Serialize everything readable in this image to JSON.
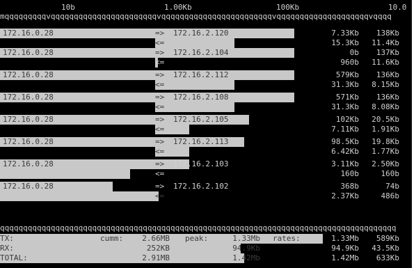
{
  "scale": {
    "labels": [
      "10b",
      "1.00Kb",
      "100Kb",
      "10.0"
    ]
  },
  "top_separator": "mqqqqqqqqqvqqqqqqqqqqqqqqqqqqqqqqqvqqqqqqqqqqqqqqqqqqqqqqqqvqqqqqqqqqqqqqqqqqqqqvqqqq",
  "sent_arrow": "=>",
  "recv_arrow": "<=",
  "connections": [
    {
      "src": "172.16.0.28",
      "dst": "172.16.2.120",
      "tx": {
        "r1": "7.33Kb",
        "r2": "138Kb"
      },
      "rx": {
        "r1": "15.3Kb",
        "r2": "11.4Kb"
      }
    },
    {
      "src": "172.16.0.28",
      "dst": "172.16.2.104",
      "tx": {
        "r1": "0b",
        "r2": "137Kb"
      },
      "rx": {
        "r1": "960b",
        "r2": "11.6Kb"
      }
    },
    {
      "src": "172.16.0.28",
      "dst": "172.16.2.112",
      "tx": {
        "r1": "579Kb",
        "r2": "136Kb"
      },
      "rx": {
        "r1": "31.3Kb",
        "r2": "8.15Kb"
      }
    },
    {
      "src": "172.16.0.28",
      "dst": "172.16.2.108",
      "tx": {
        "r1": "571Kb",
        "r2": "136Kb"
      },
      "rx": {
        "r1": "31.3Kb",
        "r2": "8.08Kb"
      }
    },
    {
      "src": "172.16.0.28",
      "dst": "172.16.2.105",
      "tx": {
        "r1": "102Kb",
        "r2": "20.5Kb"
      },
      "rx": {
        "r1": "7.11Kb",
        "r2": "1.91Kb"
      }
    },
    {
      "src": "172.16.0.28",
      "dst": "172.16.2.113",
      "tx": {
        "r1": "98.5Kb",
        "r2": "19.8Kb"
      },
      "rx": {
        "r1": "6.42Kb",
        "r2": "1.77Kb"
      }
    },
    {
      "src": "172.16.0.28",
      "dst": "172.16.2.103",
      "tx": {
        "r1": "3.11Kb",
        "r2": "2.50Kb"
      },
      "rx": {
        "r1": "160b",
        "r2": "160b"
      }
    },
    {
      "src": "172.16.0.28",
      "dst": "172.16.2.102",
      "tx": {
        "r1": "368b",
        "r2": "74b"
      },
      "rx": {
        "r1": "2.37Kb",
        "r2": "486b"
      }
    }
  ],
  "bottom_separator": "qqqqqqqqqqqqqqqqqqqqqqqqqqqqqqqqqqqqqqqqqqqqqqqqqqqqqqqqqqqqqqqqqqqqqqqqqqqqqqqqqqqqqq",
  "totals": {
    "tx": {
      "label": "TX:",
      "cumm_label": "cumm:",
      "cumm": "2.66MB",
      "peak_label": "peak:",
      "peak": "1.33Mb",
      "rates_label": "rates:",
      "r1": "1.33Mb",
      "r2": "589Kb"
    },
    "rx": {
      "label": "RX:",
      "cumm": "252KB",
      "peak": "94.9Kb",
      "r1": "94.9Kb",
      "r2": "43.5Kb"
    },
    "total": {
      "label": "TOTAL:",
      "cumm": "2.91MB",
      "peak": "1.42Mb",
      "r1": "1.42Mb",
      "r2": "633Kb"
    }
  }
}
